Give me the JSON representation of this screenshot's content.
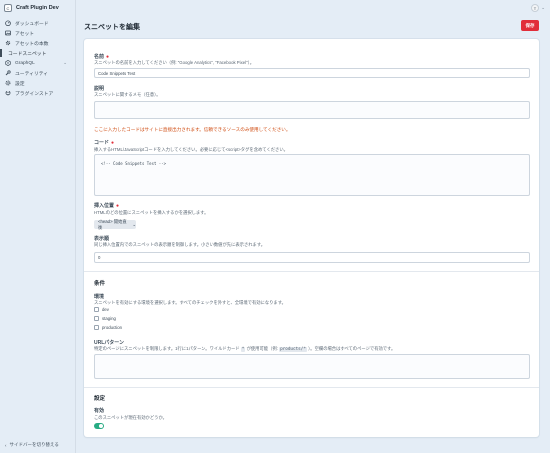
{
  "app": {
    "badge": "C",
    "name": "Craft Plugin Dev"
  },
  "sidebar": {
    "items": [
      {
        "icon": "dashboard-icon",
        "label": "ダッシュボード"
      },
      {
        "icon": "assets-icon",
        "label": "アセット"
      },
      {
        "icon": "gear-icon",
        "label": "アセットの本数"
      },
      {
        "icon": "",
        "label": "コードスニペット"
      },
      {
        "icon": "graphql-icon",
        "label": "GraphQL"
      },
      {
        "icon": "wrench-icon",
        "label": "ユーティリティ"
      },
      {
        "icon": "settings-icon",
        "label": "設定"
      },
      {
        "icon": "plug-icon",
        "label": "プラグインストア"
      }
    ],
    "collapse_label": "サイドバーを切り替える"
  },
  "user": {
    "initial": "T"
  },
  "header": {
    "title": "スニペットを編集",
    "save_label": "保存"
  },
  "form": {
    "name": {
      "label": "名前",
      "help": "スニペットの名前を入力してください（例: \"Google Analytics\", \"Facebook Pixel\"）。",
      "value": "Code Snippets Test"
    },
    "description": {
      "label": "説明",
      "help": "スニペットに関するメモ（任意）。",
      "value": ""
    },
    "warning": "ここに入力したコードはサイトに直接出力されます。信頼できるソースのみ使用してください。",
    "code": {
      "label": "コード",
      "help": "挿入するHTML/JavaScriptコードを入力してください。必要に応じて<script>タグを含めてください。",
      "value": "<!-- Code Snippets Test -->"
    },
    "position": {
      "label": "挿入位置",
      "help": "HTMLのどの位置にスニペットを挿入するかを選択します。",
      "selected": "<head> 開始直後"
    },
    "order": {
      "label": "表示順",
      "help": "同じ挿入位置内でのスニペットの表示順を制御します。小さい数値が先に表示されます。",
      "value": "0"
    },
    "conditions": {
      "heading": "条件",
      "env_label": "環境",
      "env_help": "スニペットを有効にする環境を選択します。すべてのチェックを外すと、全環境で有効になります。",
      "environments": [
        "dev",
        "staging",
        "production"
      ],
      "url_label": "URLパターン",
      "url_help_1": "特定のページにスニペットを制限します。1行に1パターン。ワイルドカード",
      "url_help_chip1": "*",
      "url_help_2": "が使用可能（例:",
      "url_help_chip2": "products/*",
      "url_help_3": "）。空欄の場合はすべてのページで有効です。",
      "url_value": ""
    },
    "settings": {
      "heading": "設定",
      "enabled_label": "有効",
      "enabled_help": "このスニペットが現在有効かどうか。",
      "enabled": true
    }
  },
  "colors": {
    "accent": "#e12d39",
    "toggle_on": "#27ab83",
    "warning": "#cf4a0f"
  }
}
